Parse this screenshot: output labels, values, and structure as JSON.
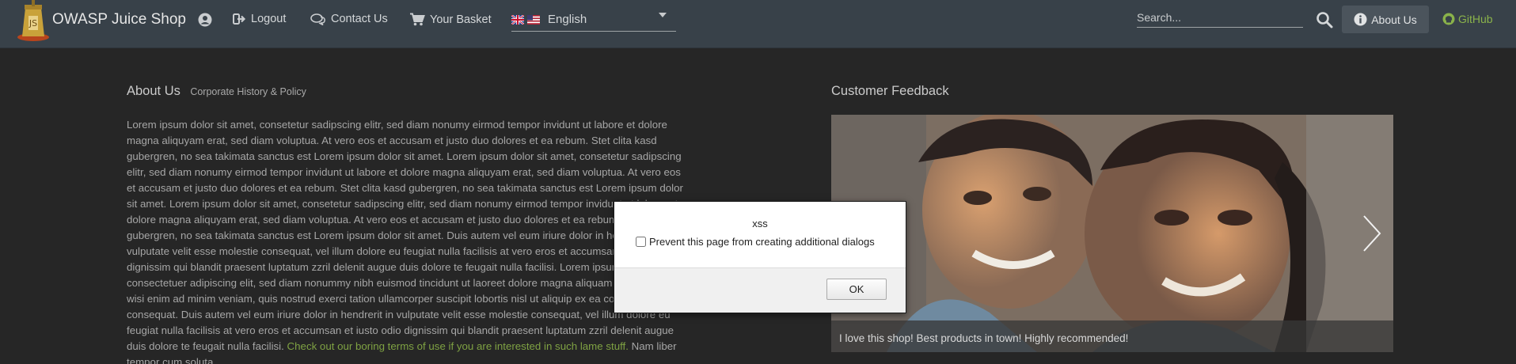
{
  "navbar": {
    "brand": "OWASP Juice Shop",
    "links": {
      "logout": "Logout",
      "contact": "Contact Us",
      "basket": "Your Basket"
    },
    "language": {
      "selected": "English"
    },
    "search": {
      "placeholder": "Search..."
    },
    "about_button": "About Us",
    "github": "GitHub"
  },
  "about": {
    "title": "About Us",
    "subtitle": "Corporate History & Policy",
    "text_before_link": "Lorem ipsum dolor sit amet, consetetur sadipscing elitr, sed diam nonumy eirmod tempor invidunt ut labore et dolore magna aliquyam erat, sed diam voluptua. At vero eos et accusam et justo duo dolores et ea rebum. Stet clita kasd gubergren, no sea takimata sanctus est Lorem ipsum dolor sit amet. Lorem ipsum dolor sit amet, consetetur sadipscing elitr, sed diam nonumy eirmod tempor invidunt ut labore et dolore magna aliquyam erat, sed diam voluptua. At vero eos et accusam et justo duo dolores et ea rebum. Stet clita kasd gubergren, no sea takimata sanctus est Lorem ipsum dolor sit amet. Lorem ipsum dolor sit amet, consetetur sadipscing elitr, sed diam nonumy eirmod tempor invidunt ut labore et dolore magna aliquyam erat, sed diam voluptua. At vero eos et accusam et justo duo dolores et ea rebum. Stet clita kasd gubergren, no sea takimata sanctus est Lorem ipsum dolor sit amet. Duis autem vel eum iriure dolor in hendrerit in vulputate velit esse molestie consequat, vel illum dolore eu feugiat nulla facilisis at vero eros et accumsan et iusto odio dignissim qui blandit praesent luptatum zzril delenit augue duis dolore te feugait nulla facilisi. Lorem ipsum dolor sit amet, consectetuer adipiscing elit, sed diam nonummy nibh euismod tincidunt ut laoreet dolore magna aliquam erat volutpat. Ut wisi enim ad minim veniam, quis nostrud exerci tation ullamcorper suscipit lobortis nisl ut aliquip ex ea commodo consequat. Duis autem vel eum iriure dolor in hendrerit in vulputate velit esse molestie consequat, vel illum dolore eu feugiat nulla facilisis at vero eros et accumsan et iusto odio dignissim qui blandit praesent luptatum zzril delenit augue duis dolore te feugait nulla facilisi.",
    "link_text": "Check out our boring terms of use if you are interested in such lame stuff.",
    "text_after_link": "Nam liber tempor cum soluta"
  },
  "feedback": {
    "title": "Customer Feedback",
    "caption": "I love this shop! Best products in town! Highly recommended!"
  },
  "dialog": {
    "message": "xss",
    "checkbox_label": "Prevent this page from creating additional dialogs",
    "ok": "OK"
  },
  "colors": {
    "navbar_bg": "#384149",
    "page_bg": "#262626",
    "link_green": "#7fa243"
  }
}
